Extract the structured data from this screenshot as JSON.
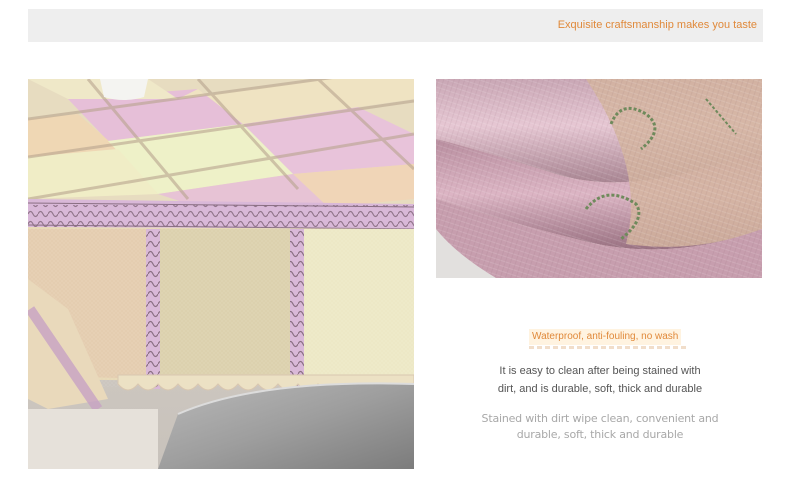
{
  "banner": {
    "tagline": "Exquisite craftsmanship makes you taste"
  },
  "photos": {
    "tablecloth": {
      "subject": "tablecloth-photo"
    },
    "rolled_fabric": {
      "subject": "rolled-fabric-photo"
    }
  },
  "feature": {
    "title": "Waterproof, anti-fouling, no wash",
    "description_lines": [
      "It is easy to clean after being stained with",
      "dirt, and is durable, soft, thick and durable"
    ],
    "note_lines": [
      "Stained with dirt wipe clean, convenient and",
      "durable, soft, thick and durable"
    ]
  },
  "colors": {
    "accent": "#e0893a",
    "banner_bg": "#eeeeee",
    "body_text": "#555555",
    "muted_text": "#a8a8a8"
  }
}
